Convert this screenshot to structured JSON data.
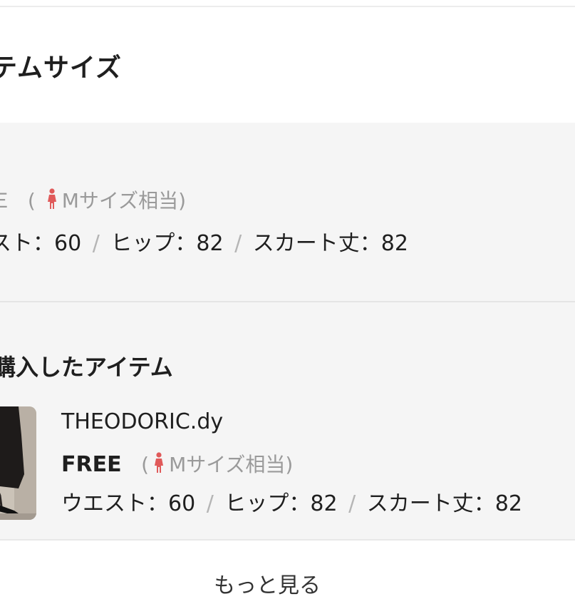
{
  "header": {
    "title": "テムサイズ"
  },
  "my_size": {
    "size_label_partial": "Ｅ",
    "paren_open": "(",
    "size_equiv": "Mサイズ相当)",
    "waist_label": "スト：",
    "waist_value": "60",
    "hip_label": "ヒップ：",
    "hip_value": "82",
    "skirt_label": "スカート丈：",
    "skirt_value": "82",
    "separator": "/"
  },
  "purchased": {
    "title": "購入したアイテム",
    "brand": "THEODORIC.dy",
    "size": "FREE",
    "paren_open": "(",
    "size_equiv": "Mサイズ相当)",
    "waist_label": "ウエスト：",
    "waist_value": "60",
    "hip_label": "ヒップ：",
    "hip_value": "82",
    "skirt_label": "スカート丈：",
    "skirt_value": "82",
    "separator": "/"
  },
  "footer": {
    "cut_text": "もっと見る"
  },
  "colors": {
    "accent_icon": "#e05a5a",
    "panel_bg": "#f5f5f5",
    "muted_text": "#9a9a9a"
  },
  "icons": [
    "person-female-icon"
  ]
}
